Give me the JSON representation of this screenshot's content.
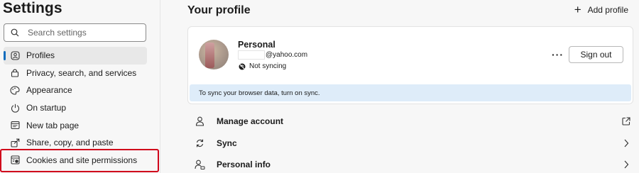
{
  "sidebar": {
    "title": "Settings",
    "search_placeholder": "Search settings",
    "items": [
      {
        "label": "Profiles",
        "icon": "profiles-icon",
        "active": true
      },
      {
        "label": "Privacy, search, and services",
        "icon": "lock-icon"
      },
      {
        "label": "Appearance",
        "icon": "appearance-icon"
      },
      {
        "label": "On startup",
        "icon": "power-icon"
      },
      {
        "label": "New tab page",
        "icon": "new-tab-icon"
      },
      {
        "label": "Share, copy, and paste",
        "icon": "share-icon"
      },
      {
        "label": "Cookies and site permissions",
        "icon": "cookies-icon"
      }
    ]
  },
  "main": {
    "title": "Your profile",
    "add_profile_label": "Add profile",
    "profile": {
      "name": "Personal",
      "email": "@yahoo.com",
      "sync_status": "Not syncing",
      "more_label": "···",
      "sign_out_label": "Sign out",
      "sync_banner": "To sync your browser data, turn on sync."
    },
    "rows": [
      {
        "label": "Manage account",
        "icon": "person-icon",
        "trail": "external-link-icon"
      },
      {
        "label": "Sync",
        "icon": "sync-icon",
        "trail": "chevron-right-icon"
      },
      {
        "label": "Personal info",
        "icon": "personal-info-icon",
        "trail": "chevron-right-icon"
      }
    ]
  },
  "colors": {
    "accent": "#0f6cbd",
    "highlight": "#d0021b",
    "banner": "#deecf9"
  }
}
